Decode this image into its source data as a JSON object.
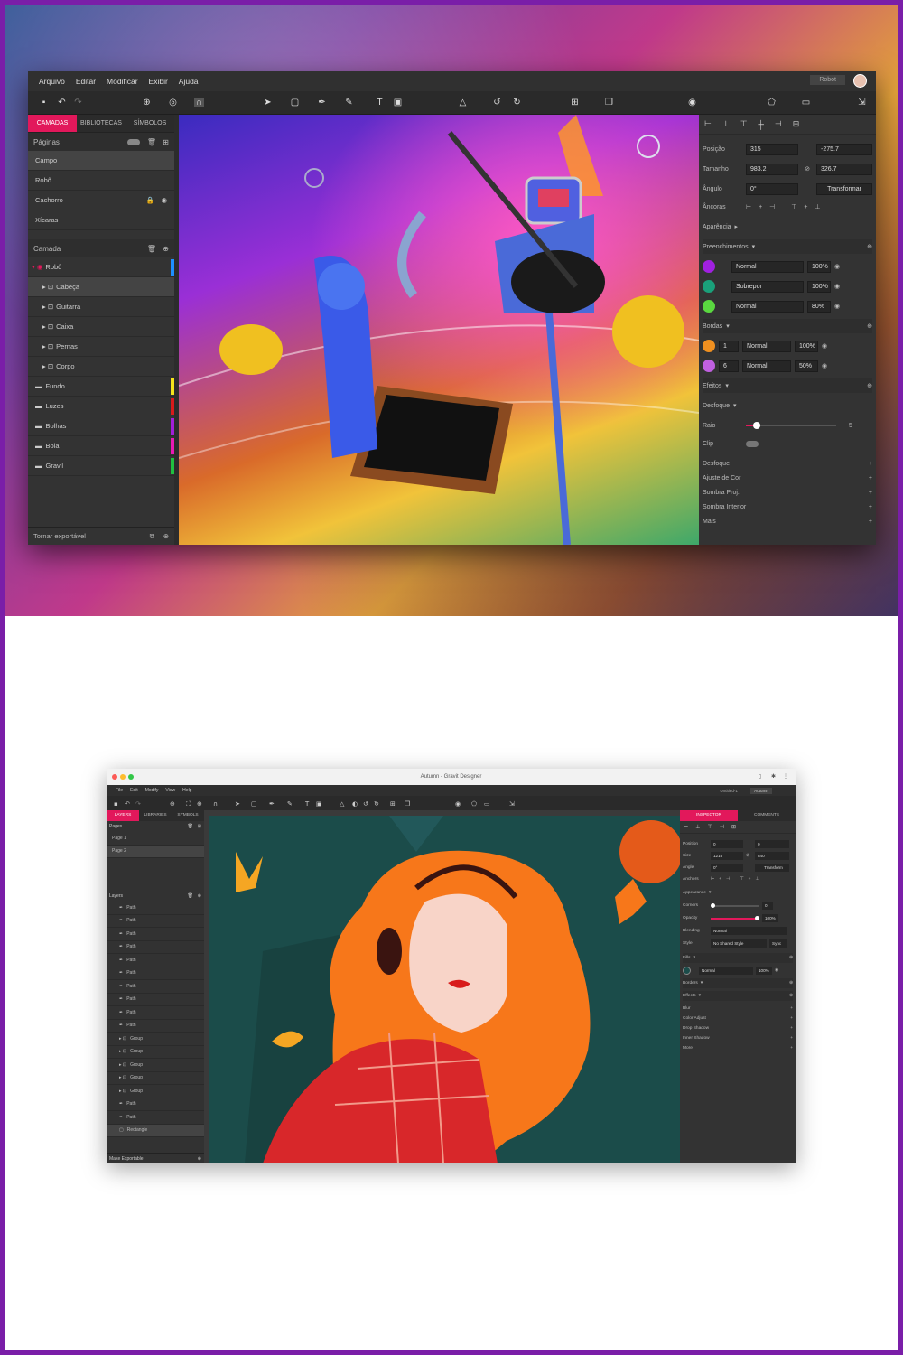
{
  "top": {
    "menu": [
      "Arquivo",
      "Editar",
      "Modificar",
      "Exibir",
      "Ajuda"
    ],
    "doc_tab": "Robot",
    "left_tabs": [
      "CAMADAS",
      "BIBLIOTECAS",
      "SÍMBOLOS"
    ],
    "pages_label": "Páginas",
    "pages": [
      "Campo",
      "Robô",
      "Cachorro",
      "Xícaras"
    ],
    "layer_label": "Camada",
    "layers": [
      {
        "label": "Robô",
        "color": "#1e90ff"
      },
      {
        "label": "Cabeça",
        "color": ""
      },
      {
        "label": "Guitarra",
        "color": ""
      },
      {
        "label": "Caixa",
        "color": ""
      },
      {
        "label": "Pernas",
        "color": ""
      },
      {
        "label": "Corpo",
        "color": ""
      },
      {
        "label": "Fundo",
        "color": "#f4e41c"
      },
      {
        "label": "Luzes",
        "color": "#d81b1b"
      },
      {
        "label": "Bolhas",
        "color": "#a21fd8"
      },
      {
        "label": "Bola",
        "color": "#e91ab5"
      },
      {
        "label": "Gravil",
        "color": "#20c040"
      }
    ],
    "make_exportable": "Tornar exportável",
    "inspector": {
      "position_label": "Posição",
      "x": "315",
      "y": "-275.7",
      "size_label": "Tamanho",
      "w": "983.2",
      "h": "326.7",
      "angle_label": "Ângulo",
      "angle": "0°",
      "transform": "Transformar",
      "anchors_label": "Âncoras",
      "appearance": "Aparência",
      "fills": "Preenchimentos",
      "fill_rows": [
        {
          "mode": "Normal",
          "pct": "100%",
          "color": "#a020e0"
        },
        {
          "mode": "Sobrepor",
          "pct": "100%",
          "color": "#1aa07a"
        },
        {
          "mode": "Normal",
          "pct": "80%",
          "color": "#5ad840"
        }
      ],
      "borders": "Bordas",
      "border_rows": [
        {
          "width": "1",
          "mode": "Normal",
          "pct": "100%",
          "color": "#f09020"
        },
        {
          "width": "6",
          "mode": "Normal",
          "pct": "50%",
          "color": "#c060e0"
        }
      ],
      "effects": "Efeitos",
      "blur_header": "Desfoque",
      "radius_label": "Raio",
      "radius": "5",
      "clip_label": "Clip",
      "effect_list": [
        "Desfoque",
        "Ajuste de Cor",
        "Sombra Proj.",
        "Sombra Interior",
        "Mais"
      ]
    }
  },
  "bottom": {
    "window_title": "Autumn - Gravit Designer",
    "menu": [
      "File",
      "Edit",
      "Modify",
      "View",
      "Help"
    ],
    "doc_tabs": [
      "Untitled-1",
      "Autumn"
    ],
    "left_tabs": [
      "LAYERS",
      "LIBRARIES",
      "SYMBOLS"
    ],
    "pages_label": "Pages",
    "pages": [
      "Page 1",
      "Page 2"
    ],
    "layers_label": "Layers",
    "layers": [
      "Path",
      "Path",
      "Path",
      "Path",
      "Path",
      "Path",
      "Path",
      "Path",
      "Path",
      "Path",
      "Group",
      "Group",
      "Group",
      "Group",
      "Group",
      "Path",
      "Path",
      "Rectangle"
    ],
    "make_exportable": "Make Exportable",
    "right_tabs": [
      "INSPECTOR",
      "COMMENTS"
    ],
    "inspector": {
      "position": "Position",
      "x": "0",
      "y": "0",
      "size": "Size",
      "w": "1216",
      "h": "840",
      "angle": "Angle",
      "angle_val": "0°",
      "transform": "Transform",
      "anchors": "Anchors",
      "appearance": "Appearance",
      "corners": "Corners",
      "corners_val": "0",
      "opacity": "Opacity",
      "opacity_val": "100%",
      "blending": "Blending",
      "blending_val": "Normal",
      "style": "Style",
      "style_val": "No Shared Style",
      "sync": "Sync",
      "fills": "Fills",
      "fill_mode": "Normal",
      "fill_pct": "100%",
      "borders": "Borders",
      "effects": "Effects",
      "effect_list": [
        "Blur",
        "Color Adjust",
        "Drop Shadow",
        "Inner Shadow",
        "More"
      ]
    }
  }
}
